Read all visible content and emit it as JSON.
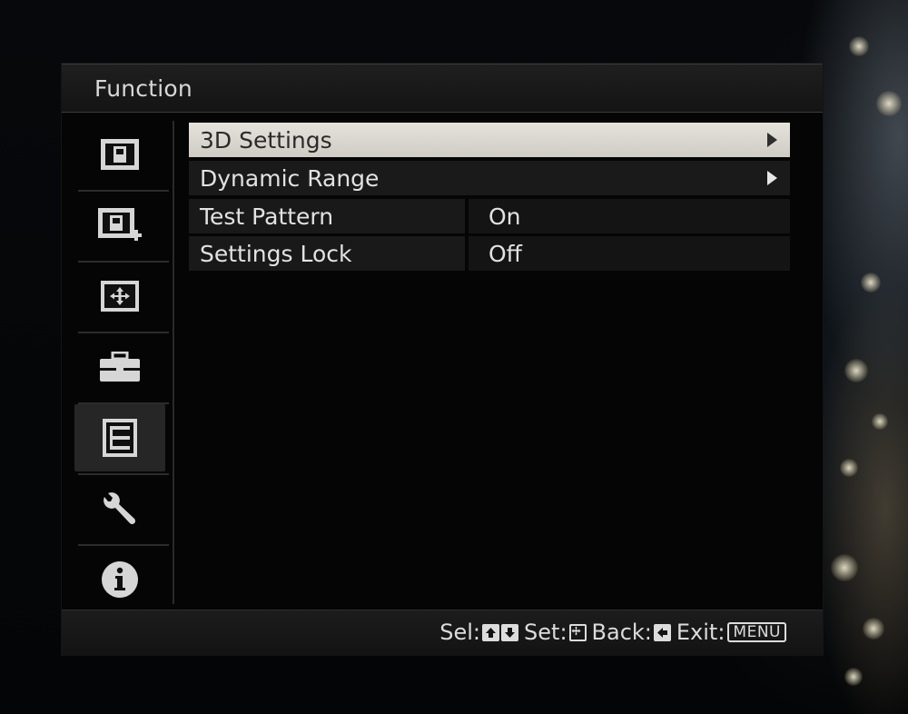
{
  "panel": {
    "title": "Function"
  },
  "sidebar": {
    "items": [
      {
        "icon": "picture-icon",
        "active": false
      },
      {
        "icon": "picture-plus-icon",
        "active": false
      },
      {
        "icon": "display-arrows-icon",
        "active": false
      },
      {
        "icon": "toolbox-icon",
        "active": false
      },
      {
        "icon": "function-list-icon",
        "active": true
      },
      {
        "icon": "wrench-icon",
        "active": false
      },
      {
        "icon": "info-icon",
        "active": false
      }
    ]
  },
  "menu": {
    "items": [
      {
        "label": "3D Settings",
        "type": "submenu",
        "selected": true
      },
      {
        "label": "Dynamic Range",
        "type": "submenu",
        "selected": false
      },
      {
        "label": "Test Pattern",
        "type": "value",
        "value": "On"
      },
      {
        "label": "Settings Lock",
        "type": "value",
        "value": "Off"
      }
    ]
  },
  "footer": {
    "sel": "Sel:",
    "set": "Set:",
    "back": "Back:",
    "exit": "Exit:",
    "menu_key": "MENU"
  },
  "colors": {
    "selected_row": "#dcd9d2",
    "text": "#e2e2e2",
    "panel_bg": "#050505"
  }
}
